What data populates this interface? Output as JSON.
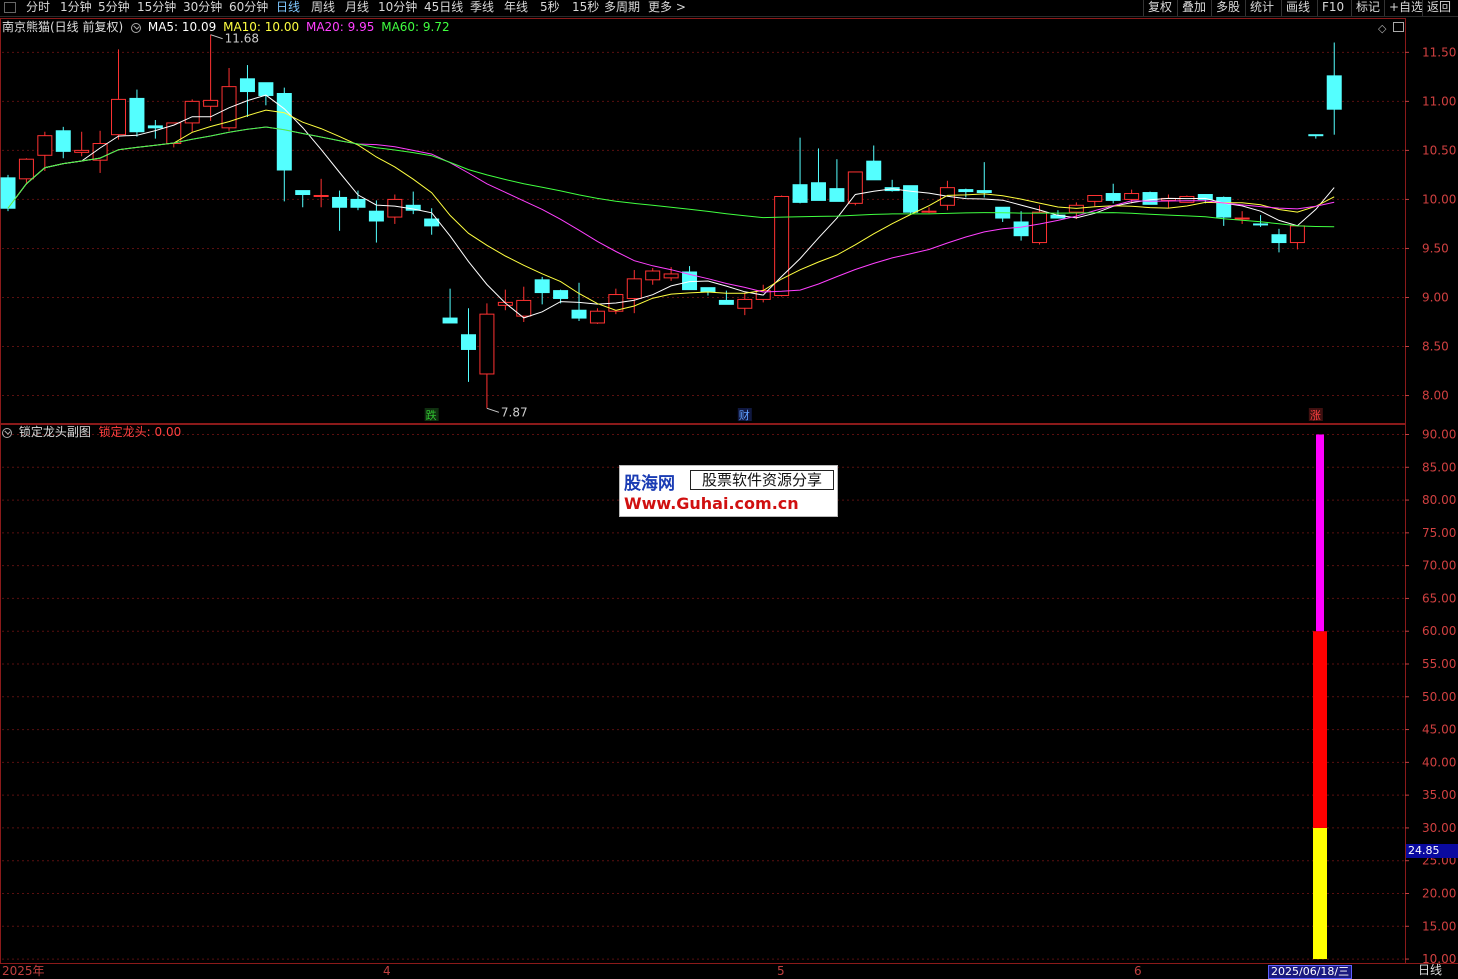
{
  "toolbar": {
    "periods": [
      "分时",
      "1分钟",
      "5分钟",
      "15分钟",
      "30分钟",
      "60分钟",
      "日线",
      "周线",
      "月线",
      "10分钟",
      "45日线",
      "季线",
      "年线",
      "5秒",
      "15秒",
      "多周期",
      "更多 >"
    ],
    "active_period": "日线",
    "right_menu": [
      "复权",
      "叠加",
      "多股",
      "统计",
      "画线",
      "F10",
      "标记",
      "+自选",
      "返回"
    ]
  },
  "main_chart": {
    "stock_title": "南京熊猫(日线 前复权)",
    "ma": [
      {
        "label": "MA5: 10.09",
        "color": "#ffffff"
      },
      {
        "label": "MA10: 10.00",
        "color": "#ffff40"
      },
      {
        "label": "MA20: 9.95",
        "color": "#ff40ff"
      },
      {
        "label": "MA60: 9.72",
        "color": "#40ff40"
      }
    ],
    "high_marker": "11.68",
    "low_marker": "7.87",
    "price_ticks": [
      "11.50",
      "11.00",
      "10.50",
      "10.00",
      "9.50",
      "9.00",
      "8.50",
      "8.00"
    ],
    "price_range": [
      7.72,
      11.85
    ],
    "signals": [
      {
        "text": "跌",
        "color": "#30c030",
        "bg": "#103010"
      },
      {
        "text": "财",
        "color": "#60a0ff",
        "bg": "#101840"
      },
      {
        "text": "涨",
        "color": "#ff4040",
        "bg": "#401010"
      }
    ]
  },
  "sub_chart": {
    "title": "锁定龙头副图",
    "indicator": "锁定龙头: 0.00",
    "value_ticks": [
      "90.00",
      "85.00",
      "80.00",
      "75.00",
      "70.00",
      "65.00",
      "60.00",
      "55.00",
      "50.00",
      "45.00",
      "40.00",
      "35.00",
      "30.00",
      "25.00",
      "20.00",
      "15.00",
      "10.00"
    ],
    "value_range": [
      9.4,
      91.6
    ],
    "current_value": "24.85",
    "bar_segments": [
      {
        "from": 10,
        "to": 30,
        "color": "#ffff00"
      },
      {
        "from": 30,
        "to": 60,
        "color": "#ff0000"
      },
      {
        "from": 60,
        "to": 90,
        "color": "#ff00ff"
      }
    ]
  },
  "watermark": {
    "cn_name": "股海网",
    "subtitle": "股票软件资源分享",
    "url": "Www.Guhai.com.cn"
  },
  "bottom_axis": {
    "labels": [
      "2025年",
      "4",
      "5",
      "6"
    ],
    "current_date": "2025/06/18/三",
    "period_tag": "日线"
  },
  "chart_data": {
    "type": "candlestick",
    "candles": [
      [
        10.22,
        10.25,
        9.88,
        9.91
      ],
      [
        10.21,
        10.42,
        10.17,
        10.41
      ],
      [
        10.45,
        10.69,
        10.29,
        10.65
      ],
      [
        10.7,
        10.74,
        10.42,
        10.49
      ],
      [
        10.48,
        10.69,
        10.44,
        10.5
      ],
      [
        10.4,
        10.7,
        10.27,
        10.57
      ],
      [
        10.66,
        11.53,
        10.61,
        11.02
      ],
      [
        11.03,
        11.12,
        10.64,
        10.69
      ],
      [
        10.75,
        10.81,
        10.62,
        10.73
      ],
      [
        10.57,
        10.78,
        10.53,
        10.78
      ],
      [
        10.78,
        11.02,
        10.69,
        11.0
      ],
      [
        10.95,
        11.68,
        10.8,
        11.01
      ],
      [
        10.73,
        11.34,
        10.7,
        11.15
      ],
      [
        11.23,
        11.37,
        10.84,
        11.1
      ],
      [
        11.19,
        11.06,
        10.96,
        11.06
      ],
      [
        11.08,
        11.14,
        9.98,
        10.3
      ],
      [
        10.09,
        10.08,
        9.92,
        10.05
      ],
      [
        10.03,
        10.21,
        9.92,
        10.04
      ],
      [
        10.02,
        10.09,
        9.68,
        9.92
      ],
      [
        10.0,
        10.09,
        9.89,
        9.92
      ],
      [
        9.88,
        9.99,
        9.56,
        9.78
      ],
      [
        9.82,
        10.05,
        9.75,
        10.0
      ],
      [
        9.94,
        10.08,
        9.85,
        9.89
      ],
      [
        9.8,
        9.91,
        9.64,
        9.73
      ],
      [
        8.79,
        9.09,
        8.75,
        8.74
      ],
      [
        8.62,
        8.89,
        8.14,
        8.47
      ],
      [
        8.22,
        8.94,
        7.87,
        8.83
      ],
      [
        8.92,
        9.08,
        8.87,
        8.95
      ],
      [
        8.81,
        9.11,
        8.75,
        8.97
      ],
      [
        9.18,
        9.21,
        8.93,
        9.05
      ],
      [
        9.07,
        9.08,
        8.94,
        8.99
      ],
      [
        8.87,
        9.15,
        8.76,
        8.79
      ],
      [
        8.74,
        8.89,
        8.73,
        8.86
      ],
      [
        8.86,
        9.09,
        8.83,
        9.03
      ],
      [
        8.99,
        9.28,
        8.84,
        9.19
      ],
      [
        9.18,
        9.3,
        9.13,
        9.27
      ],
      [
        9.2,
        9.31,
        9.17,
        9.24
      ],
      [
        9.26,
        9.32,
        9.08,
        9.08
      ],
      [
        9.1,
        9.09,
        9.02,
        9.06
      ],
      [
        8.97,
        9.07,
        8.94,
        8.93
      ],
      [
        8.89,
        9.05,
        8.82,
        8.98
      ],
      [
        8.98,
        9.13,
        8.95,
        9.07
      ],
      [
        9.02,
        10.04,
        9.01,
        10.03
      ],
      [
        10.15,
        10.63,
        9.96,
        9.97
      ],
      [
        10.17,
        10.52,
        10.02,
        9.99
      ],
      [
        10.11,
        10.41,
        10.03,
        9.98
      ],
      [
        9.96,
        10.25,
        9.94,
        10.28
      ],
      [
        10.39,
        10.55,
        10.2,
        10.2
      ],
      [
        10.12,
        10.2,
        10.08,
        10.09
      ],
      [
        10.14,
        10.09,
        9.85,
        9.87
      ],
      [
        9.88,
        9.92,
        9.86,
        9.88
      ],
      [
        9.94,
        10.19,
        9.89,
        10.12
      ],
      [
        10.1,
        10.11,
        10.02,
        10.08
      ],
      [
        10.09,
        10.38,
        10.02,
        10.07
      ],
      [
        9.92,
        9.91,
        9.77,
        9.81
      ],
      [
        9.77,
        9.88,
        9.58,
        9.63
      ],
      [
        9.56,
        9.94,
        9.54,
        9.87
      ],
      [
        9.84,
        9.89,
        9.81,
        9.81
      ],
      [
        9.87,
        9.97,
        9.8,
        9.94
      ],
      [
        9.98,
        10.03,
        9.93,
        10.04
      ],
      [
        10.06,
        10.16,
        9.96,
        9.99
      ],
      [
        10.0,
        10.1,
        9.96,
        10.06
      ],
      [
        10.07,
        10.08,
        9.96,
        9.95
      ],
      [
        9.99,
        10.05,
        9.91,
        10.01
      ],
      [
        9.97,
        10.04,
        9.98,
        10.03
      ],
      [
        10.05,
        10.04,
        9.96,
        10.0
      ],
      [
        10.02,
        10.03,
        9.73,
        9.82
      ],
      [
        9.8,
        9.88,
        9.75,
        9.81
      ],
      [
        9.75,
        9.84,
        9.72,
        9.74
      ],
      [
        9.64,
        9.7,
        9.46,
        9.56
      ],
      [
        9.56,
        9.71,
        9.49,
        9.73
      ],
      [
        10.66,
        10.66,
        10.62,
        10.65
      ],
      [
        11.26,
        11.6,
        10.66,
        10.92
      ]
    ]
  }
}
